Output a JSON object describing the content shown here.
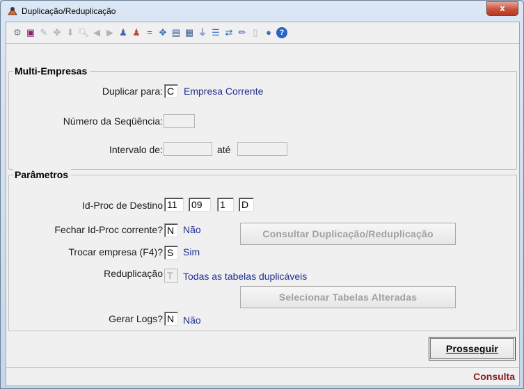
{
  "window": {
    "title": "Duplicação/Reduplicação",
    "close_glyph": "x"
  },
  "toolbar": {
    "icons": [
      {
        "name": "gear-icon",
        "glyph": "⚙",
        "enabled": true
      },
      {
        "name": "save-icon",
        "glyph": "▣",
        "enabled": true
      },
      {
        "name": "edit-icon",
        "glyph": "✎",
        "enabled": false
      },
      {
        "name": "tools-icon",
        "glyph": "✤",
        "enabled": false
      },
      {
        "name": "down-arrow-icon",
        "glyph": "⬇",
        "enabled": false
      },
      {
        "name": "preview-icon",
        "glyph": "🔍︎",
        "enabled": false
      },
      {
        "name": "prev-icon",
        "glyph": "◀",
        "enabled": false
      },
      {
        "name": "next-icon",
        "glyph": "▶",
        "enabled": false
      },
      {
        "name": "user-up-icon",
        "glyph": "♟",
        "enabled": true
      },
      {
        "name": "user-down-icon",
        "glyph": "♟",
        "enabled": true
      },
      {
        "name": "equals-icon",
        "glyph": "=",
        "enabled": true
      },
      {
        "name": "move-icon",
        "glyph": "✥",
        "enabled": true
      },
      {
        "name": "calculator-icon",
        "glyph": "▤",
        "enabled": true
      },
      {
        "name": "form-icon",
        "glyph": "▦",
        "enabled": true
      },
      {
        "name": "filter-icon",
        "glyph": "⏚",
        "enabled": true
      },
      {
        "name": "list-icon",
        "glyph": "☰",
        "enabled": true
      },
      {
        "name": "transfer-icon",
        "glyph": "⇄",
        "enabled": true
      },
      {
        "name": "pencil-icon",
        "glyph": "✏",
        "enabled": true
      },
      {
        "name": "document-icon",
        "glyph": "▯",
        "enabled": false
      },
      {
        "name": "record-icon",
        "glyph": "●",
        "enabled": true
      },
      {
        "name": "help-icon",
        "glyph": "?",
        "enabled": true
      }
    ]
  },
  "multi_empresas": {
    "title": "Multi-Empresas",
    "duplicar_label": "Duplicar para:",
    "duplicar_value": "C",
    "duplicar_desc": "Empresa Corrente",
    "sequencia_label": "Número da Seqüência:",
    "sequencia_value": "",
    "intervalo_label": "Intervalo de:",
    "intervalo_de_value": "",
    "ate_label": "até",
    "intervalo_ate_value": ""
  },
  "parametros": {
    "title": "Parâmetros",
    "idproc_label": "Id-Proc de Destino",
    "idproc_values": [
      "11",
      "09",
      "1",
      "D"
    ],
    "fechar_label": "Fechar Id-Proc corrente?",
    "fechar_value": "N",
    "fechar_desc": "Não",
    "consultar_button": "Consultar Duplicação/Reduplicação",
    "trocar_label": "Trocar empresa (F4)?",
    "trocar_value": "S",
    "trocar_desc": "Sim",
    "redup_label": "Reduplicação",
    "redup_value": "T",
    "redup_desc": "Todas as tabelas duplicáveis",
    "selecionar_button": "Selecionar Tabelas Alteradas",
    "logs_label": "Gerar Logs?",
    "logs_value": "N",
    "logs_desc": "Não"
  },
  "actions": {
    "prosseguir_button": "Prosseguir"
  },
  "status": {
    "mode": "Consulta"
  }
}
